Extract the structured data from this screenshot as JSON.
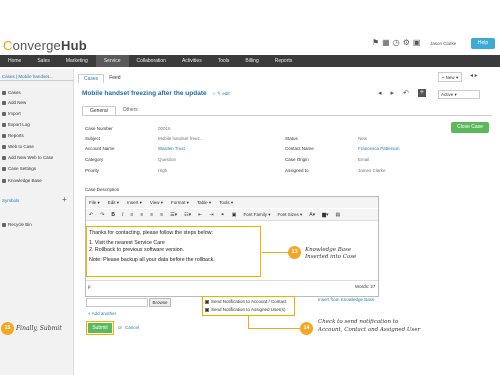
{
  "app": {
    "logo_c": "C",
    "logo_rest": "onverge",
    "logo_hub": "Hub",
    "user": "Jason Clarke",
    "help": "Help"
  },
  "nav": [
    "Home",
    "Sales",
    "Marketing",
    "Service",
    "Collaboration",
    "Activities",
    "Tools",
    "Billing",
    "Reports"
  ],
  "sidebar": {
    "tab": "Cases  |  Mobile handset...",
    "items": [
      "Cases",
      "Add New",
      "Import",
      "Export Log",
      "Reports",
      "Web to Case",
      "Add New Web to Case",
      "Case Settings",
      "Knowledge Base"
    ],
    "symbols": "Symbols",
    "recycle": "Recycle Bin"
  },
  "tabs": {
    "cases": "Cases",
    "feed": "Feed",
    "new": "New",
    "active": "Active"
  },
  "case": {
    "title": "Mobile handset freezing after the update",
    "edit": "edit",
    "general": "General",
    "others": "Others",
    "close_btn": "Close Case"
  },
  "fields": {
    "case_number_l": "Case Number",
    "case_number_v": "00016",
    "subject_l": "Subject",
    "subject_v": "Mobile handset freez...",
    "status_l": "Status",
    "status_v": "New",
    "account_l": "Account Name",
    "account_v": "Warden Trust",
    "contact_l": "Contact Name",
    "contact_v": "Francesca Patterson",
    "category_l": "Category",
    "category_v": "Question",
    "origin_l": "Case Origin",
    "origin_v": "Email",
    "priority_l": "Priority",
    "priority_v": "High",
    "assigned_l": "Assigned to",
    "assigned_v": "James Clarke"
  },
  "editor": {
    "label": "Case Description",
    "menus": [
      "File",
      "Edit",
      "Insert",
      "View",
      "Format",
      "Table",
      "Tools"
    ],
    "font_family": "Font Family",
    "font_sizes": "Font Sizes",
    "line1": "Thanks for contacting, please follow the steps below:",
    "line2": "1. Visit the nearest Service Care",
    "line3": "2. Rollback to previous software version.",
    "line4": "Note: Please backup all your data before the rollback.",
    "p": "p",
    "words": "Words: 27"
  },
  "attach": {
    "browse": "Browse",
    "add_another": "+ Add another"
  },
  "notify": {
    "account": "Send Notification to Account / Contact",
    "assigned": "Send Notification to Assigned User(s)",
    "kb_insert": "Insert from Knowledge Base"
  },
  "actions": {
    "submit": "Submit",
    "or": "or",
    "cancel": "Cancel"
  },
  "callouts": {
    "n13": "13",
    "t13a": "Knowledge Base",
    "t13b": "Inserted into Case",
    "n14": "14",
    "t14a": "Check to send notification to",
    "t14b": "Account, Contact and Assigned User",
    "n15": "15",
    "t15": "Finally, Submit"
  },
  "colors": {
    "accent": "#f5a623",
    "link": "#2a7ab0",
    "nav": "#3b3b3b",
    "success": "#5cb85c"
  }
}
